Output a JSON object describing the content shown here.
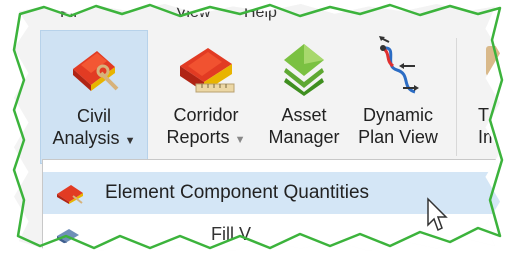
{
  "menubar": {
    "item1": "Fil",
    "item2": "View",
    "item3": "Help"
  },
  "ribbon": {
    "left_edge": "s",
    "civil_analysis": {
      "line1": "Civil",
      "line2": "Analysis",
      "caret": "▼"
    },
    "corridor_reports": {
      "line1": "Corridor",
      "line2": "Reports",
      "caret": "▼"
    },
    "asset_manager": {
      "line1": "Asset",
      "line2": "Manager"
    },
    "dynamic_plan_view": {
      "line1": "Dynamic",
      "line2": "Plan View"
    },
    "right_edge": {
      "line1": "T",
      "line2": "Im"
    }
  },
  "dropdown": {
    "items": [
      {
        "label": "Element Component Quantities",
        "icon": "component-quantities-icon"
      },
      {
        "label": "Fill V",
        "icon": "fill-volume-icon"
      }
    ]
  },
  "colors": {
    "highlight": "#d4e6f6",
    "ribbon_bg": "#f3f3f3",
    "edge_green": "#3cb33c"
  }
}
